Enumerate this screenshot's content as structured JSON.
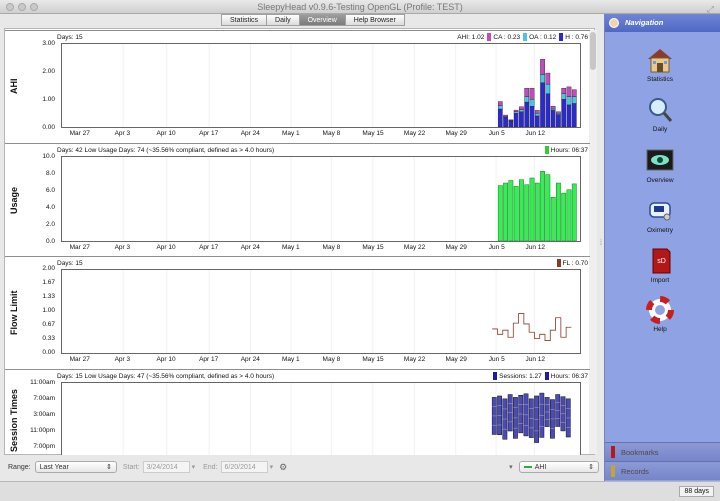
{
  "window": {
    "title": "SleepyHead v0.9.6-Testing OpenGL (Profile: TEST)"
  },
  "tabs": [
    {
      "label": "Statistics",
      "active": false
    },
    {
      "label": "Daily",
      "active": false
    },
    {
      "label": "Overview",
      "active": true
    },
    {
      "label": "Help Browser",
      "active": false
    }
  ],
  "x_axis_labels": [
    "Mar 27",
    "Apr 3",
    "Apr 10",
    "Apr 17",
    "Apr 24",
    "May 1",
    "May 8",
    "May 15",
    "May 22",
    "May 29",
    "Jun 5",
    "Jun 12"
  ],
  "panels": {
    "ahi": {
      "label": "AHI",
      "header_left": "Days: 15",
      "legend": [
        {
          "label": "AHI: 1.02",
          "color": "#ffffff"
        },
        {
          "label": "CA : 0.23",
          "color": "#c04cc0"
        },
        {
          "label": "OA : 0.12",
          "color": "#4ec3e8"
        },
        {
          "label": "H : 0.76",
          "color": "#2a2ad0"
        }
      ],
      "y_ticks": [
        "3.00",
        "2.00",
        "1.00",
        "0.00"
      ]
    },
    "usage": {
      "label": "Usage",
      "header_left": "Days: 42 Low Usage Days: 74 (~35.56% compliant, defined as > 4.0 hours)",
      "legend": [
        {
          "label": "Hours: 06:37",
          "color": "#33cc33"
        }
      ],
      "y_ticks": [
        "10.0",
        "8.0",
        "6.0",
        "4.0",
        "2.0",
        "0.0"
      ]
    },
    "flow_limit": {
      "label": "Flow Limit",
      "header_left": "Days: 15",
      "legend": [
        {
          "label": "FL : 0.70",
          "color": "#8b3a2a"
        }
      ],
      "y_ticks": [
        "2.00",
        "1.67",
        "1.33",
        "1.00",
        "0.67",
        "0.33",
        "0.00"
      ]
    },
    "session_times": {
      "label": "Session Times",
      "header_left": "Days: 15 Low Usage Days: 47 (~35.56% compliant, defined as > 4.0 hours)",
      "legend": [
        {
          "label": "Sessions: 1.27",
          "color": "#1a1ab0"
        },
        {
          "label": "Hours: 06:37",
          "color": "#1a1ab0"
        }
      ],
      "y_ticks": [
        "11:00am",
        "7:00am",
        "3:00am",
        "11:00pm",
        "7:00pm"
      ]
    }
  },
  "chart_data": [
    {
      "type": "bar",
      "title": "AHI",
      "ylim": [
        0,
        3
      ],
      "series": [
        {
          "name": "H",
          "color": "#2a2ad0",
          "values": [
            0.65,
            0.35,
            0.22,
            0.5,
            0.55,
            0.9,
            0.75,
            0.4,
            1.6,
            1.2,
            0.6,
            0.45,
            1.0,
            0.8,
            0.85
          ]
        },
        {
          "name": "OA",
          "color": "#4ec3e8",
          "values": [
            0.12,
            0.03,
            0.02,
            0.05,
            0.08,
            0.2,
            0.25,
            0.1,
            0.3,
            0.35,
            0.05,
            0.05,
            0.2,
            0.3,
            0.25
          ]
        },
        {
          "name": "CA",
          "color": "#c04cc0",
          "values": [
            0.15,
            0.05,
            0.02,
            0.06,
            0.1,
            0.3,
            0.4,
            0.1,
            0.55,
            0.4,
            0.1,
            0.05,
            0.2,
            0.35,
            0.25
          ]
        }
      ]
    },
    {
      "type": "bar",
      "title": "Usage",
      "ylim": [
        0,
        10
      ],
      "series": [
        {
          "name": "Hours",
          "color": "#33ee55",
          "values": [
            6.6,
            6.9,
            7.2,
            6.5,
            7.3,
            6.7,
            7.5,
            6.9,
            8.3,
            7.9,
            5.2,
            6.9,
            5.7,
            6.1,
            6.8
          ]
        }
      ]
    },
    {
      "type": "line",
      "title": "Flow Limit",
      "ylim": [
        0,
        2
      ],
      "series": [
        {
          "name": "FL",
          "color": "#8b3a2a",
          "values": [
            0.58,
            0.45,
            0.55,
            0.38,
            0.72,
            0.95,
            0.7,
            0.5,
            0.35,
            0.45,
            0.3,
            0.55,
            0.85,
            0.38,
            0.62
          ]
        }
      ]
    },
    {
      "type": "bar",
      "title": "Session Times",
      "series": [
        {
          "name": "Sessions",
          "color": "#4a4ab8",
          "values": [
            6.6,
            6.9,
            7.2,
            6.5,
            7.3,
            6.7,
            7.5,
            6.9,
            8.3,
            7.9,
            5.2,
            6.9,
            5.7,
            6.1,
            6.8
          ]
        }
      ]
    }
  ],
  "bottom": {
    "range_label": "Range:",
    "range_value": "Last Year",
    "start_label": "Start:",
    "start_value": "3/24/2014",
    "end_label": "End:",
    "end_value": "6/20/2014",
    "graph_select": "AHI"
  },
  "sidebar": {
    "title": "Navigation",
    "items": [
      {
        "label": "Statistics",
        "icon": "house-icon"
      },
      {
        "label": "Daily",
        "icon": "magnifier-icon"
      },
      {
        "label": "Overview",
        "icon": "eye-icon"
      },
      {
        "label": "Oximetry",
        "icon": "oximeter-icon"
      },
      {
        "label": "Import",
        "icon": "sd-card-icon"
      },
      {
        "label": "Help",
        "icon": "lifebuoy-icon"
      }
    ],
    "bookmarks": "Bookmarks",
    "records": "Records"
  },
  "status": {
    "days": "88 days"
  }
}
